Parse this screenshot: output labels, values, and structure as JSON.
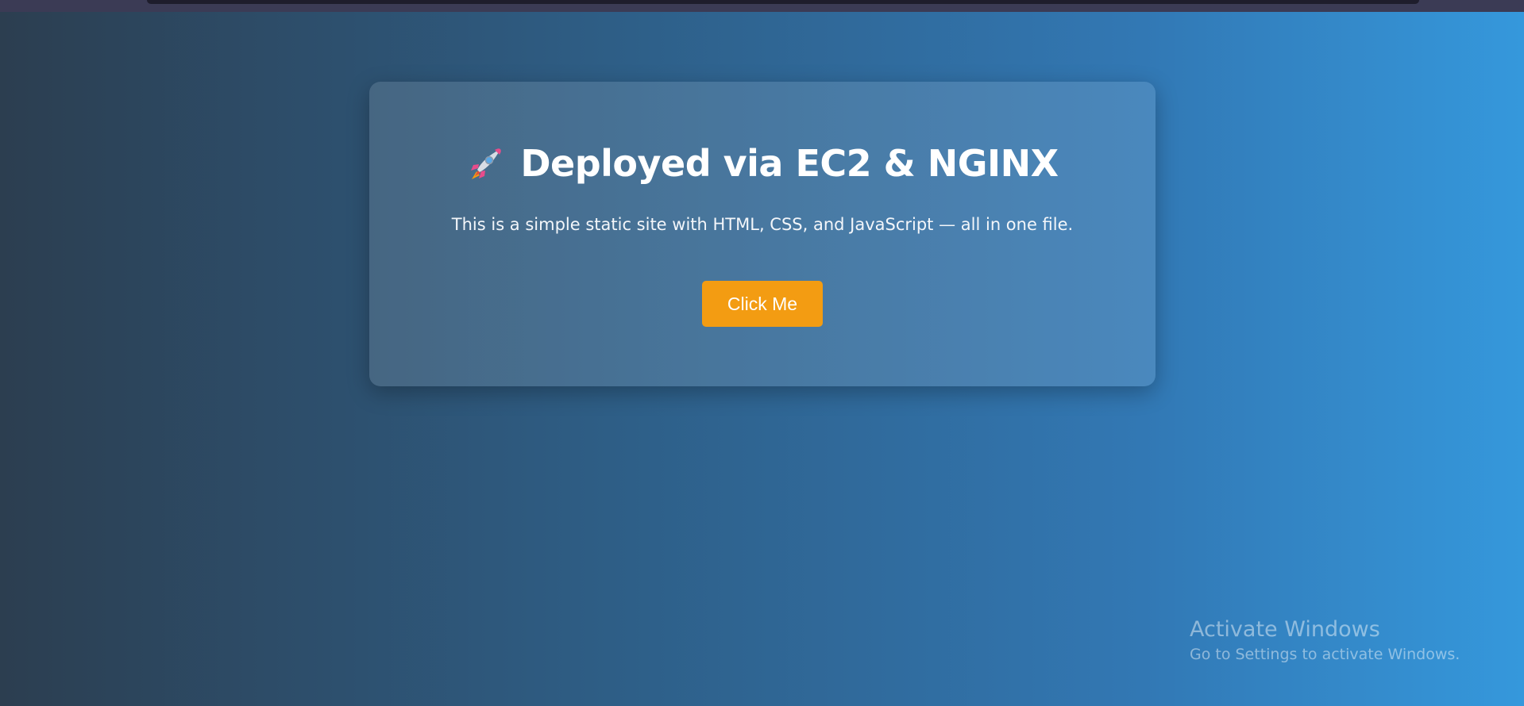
{
  "page": {
    "heading": "Deployed via EC2 & NGINX",
    "heading_icon": "rocket-icon",
    "subtitle": "This is a simple static site with HTML, CSS, and JavaScript — all in one file.",
    "button_label": "Click Me"
  },
  "watermark": {
    "title": "Activate Windows",
    "subtitle": "Go to Settings to activate Windows."
  },
  "colors": {
    "background_start": "#2c3e50",
    "background_end": "#3598dc",
    "button": "#f39c12",
    "text": "#ffffff"
  }
}
